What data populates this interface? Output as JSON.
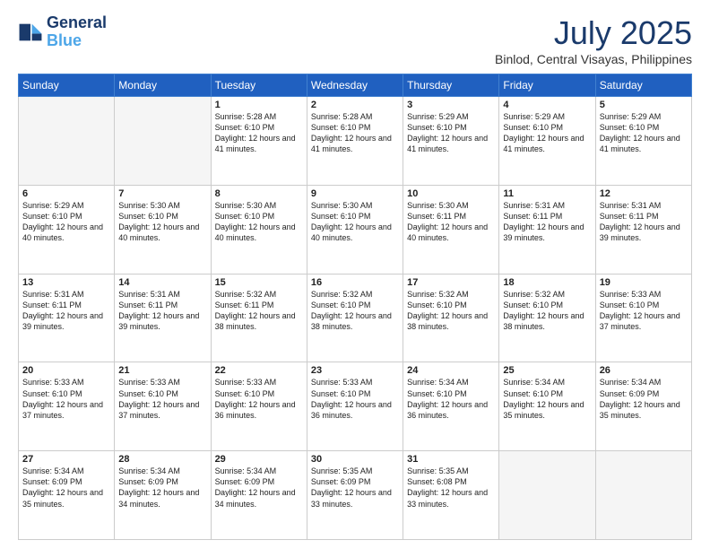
{
  "logo": {
    "line1": "General",
    "line2": "Blue"
  },
  "title": "July 2025",
  "subtitle": "Binlod, Central Visayas, Philippines",
  "days_of_week": [
    "Sunday",
    "Monday",
    "Tuesday",
    "Wednesday",
    "Thursday",
    "Friday",
    "Saturday"
  ],
  "weeks": [
    [
      {
        "day": "",
        "empty": true
      },
      {
        "day": "",
        "empty": true
      },
      {
        "day": "1",
        "sunrise": "5:28 AM",
        "sunset": "6:10 PM",
        "daylight": "12 hours and 41 minutes."
      },
      {
        "day": "2",
        "sunrise": "5:28 AM",
        "sunset": "6:10 PM",
        "daylight": "12 hours and 41 minutes."
      },
      {
        "day": "3",
        "sunrise": "5:29 AM",
        "sunset": "6:10 PM",
        "daylight": "12 hours and 41 minutes."
      },
      {
        "day": "4",
        "sunrise": "5:29 AM",
        "sunset": "6:10 PM",
        "daylight": "12 hours and 41 minutes."
      },
      {
        "day": "5",
        "sunrise": "5:29 AM",
        "sunset": "6:10 PM",
        "daylight": "12 hours and 41 minutes."
      }
    ],
    [
      {
        "day": "6",
        "sunrise": "5:29 AM",
        "sunset": "6:10 PM",
        "daylight": "12 hours and 40 minutes."
      },
      {
        "day": "7",
        "sunrise": "5:30 AM",
        "sunset": "6:10 PM",
        "daylight": "12 hours and 40 minutes."
      },
      {
        "day": "8",
        "sunrise": "5:30 AM",
        "sunset": "6:10 PM",
        "daylight": "12 hours and 40 minutes."
      },
      {
        "day": "9",
        "sunrise": "5:30 AM",
        "sunset": "6:10 PM",
        "daylight": "12 hours and 40 minutes."
      },
      {
        "day": "10",
        "sunrise": "5:30 AM",
        "sunset": "6:11 PM",
        "daylight": "12 hours and 40 minutes."
      },
      {
        "day": "11",
        "sunrise": "5:31 AM",
        "sunset": "6:11 PM",
        "daylight": "12 hours and 39 minutes."
      },
      {
        "day": "12",
        "sunrise": "5:31 AM",
        "sunset": "6:11 PM",
        "daylight": "12 hours and 39 minutes."
      }
    ],
    [
      {
        "day": "13",
        "sunrise": "5:31 AM",
        "sunset": "6:11 PM",
        "daylight": "12 hours and 39 minutes."
      },
      {
        "day": "14",
        "sunrise": "5:31 AM",
        "sunset": "6:11 PM",
        "daylight": "12 hours and 39 minutes."
      },
      {
        "day": "15",
        "sunrise": "5:32 AM",
        "sunset": "6:11 PM",
        "daylight": "12 hours and 38 minutes."
      },
      {
        "day": "16",
        "sunrise": "5:32 AM",
        "sunset": "6:10 PM",
        "daylight": "12 hours and 38 minutes."
      },
      {
        "day": "17",
        "sunrise": "5:32 AM",
        "sunset": "6:10 PM",
        "daylight": "12 hours and 38 minutes."
      },
      {
        "day": "18",
        "sunrise": "5:32 AM",
        "sunset": "6:10 PM",
        "daylight": "12 hours and 38 minutes."
      },
      {
        "day": "19",
        "sunrise": "5:33 AM",
        "sunset": "6:10 PM",
        "daylight": "12 hours and 37 minutes."
      }
    ],
    [
      {
        "day": "20",
        "sunrise": "5:33 AM",
        "sunset": "6:10 PM",
        "daylight": "12 hours and 37 minutes."
      },
      {
        "day": "21",
        "sunrise": "5:33 AM",
        "sunset": "6:10 PM",
        "daylight": "12 hours and 37 minutes."
      },
      {
        "day": "22",
        "sunrise": "5:33 AM",
        "sunset": "6:10 PM",
        "daylight": "12 hours and 36 minutes."
      },
      {
        "day": "23",
        "sunrise": "5:33 AM",
        "sunset": "6:10 PM",
        "daylight": "12 hours and 36 minutes."
      },
      {
        "day": "24",
        "sunrise": "5:34 AM",
        "sunset": "6:10 PM",
        "daylight": "12 hours and 36 minutes."
      },
      {
        "day": "25",
        "sunrise": "5:34 AM",
        "sunset": "6:10 PM",
        "daylight": "12 hours and 35 minutes."
      },
      {
        "day": "26",
        "sunrise": "5:34 AM",
        "sunset": "6:09 PM",
        "daylight": "12 hours and 35 minutes."
      }
    ],
    [
      {
        "day": "27",
        "sunrise": "5:34 AM",
        "sunset": "6:09 PM",
        "daylight": "12 hours and 35 minutes."
      },
      {
        "day": "28",
        "sunrise": "5:34 AM",
        "sunset": "6:09 PM",
        "daylight": "12 hours and 34 minutes."
      },
      {
        "day": "29",
        "sunrise": "5:34 AM",
        "sunset": "6:09 PM",
        "daylight": "12 hours and 34 minutes."
      },
      {
        "day": "30",
        "sunrise": "5:35 AM",
        "sunset": "6:09 PM",
        "daylight": "12 hours and 33 minutes."
      },
      {
        "day": "31",
        "sunrise": "5:35 AM",
        "sunset": "6:08 PM",
        "daylight": "12 hours and 33 minutes."
      },
      {
        "day": "",
        "empty": true
      },
      {
        "day": "",
        "empty": true
      }
    ]
  ]
}
